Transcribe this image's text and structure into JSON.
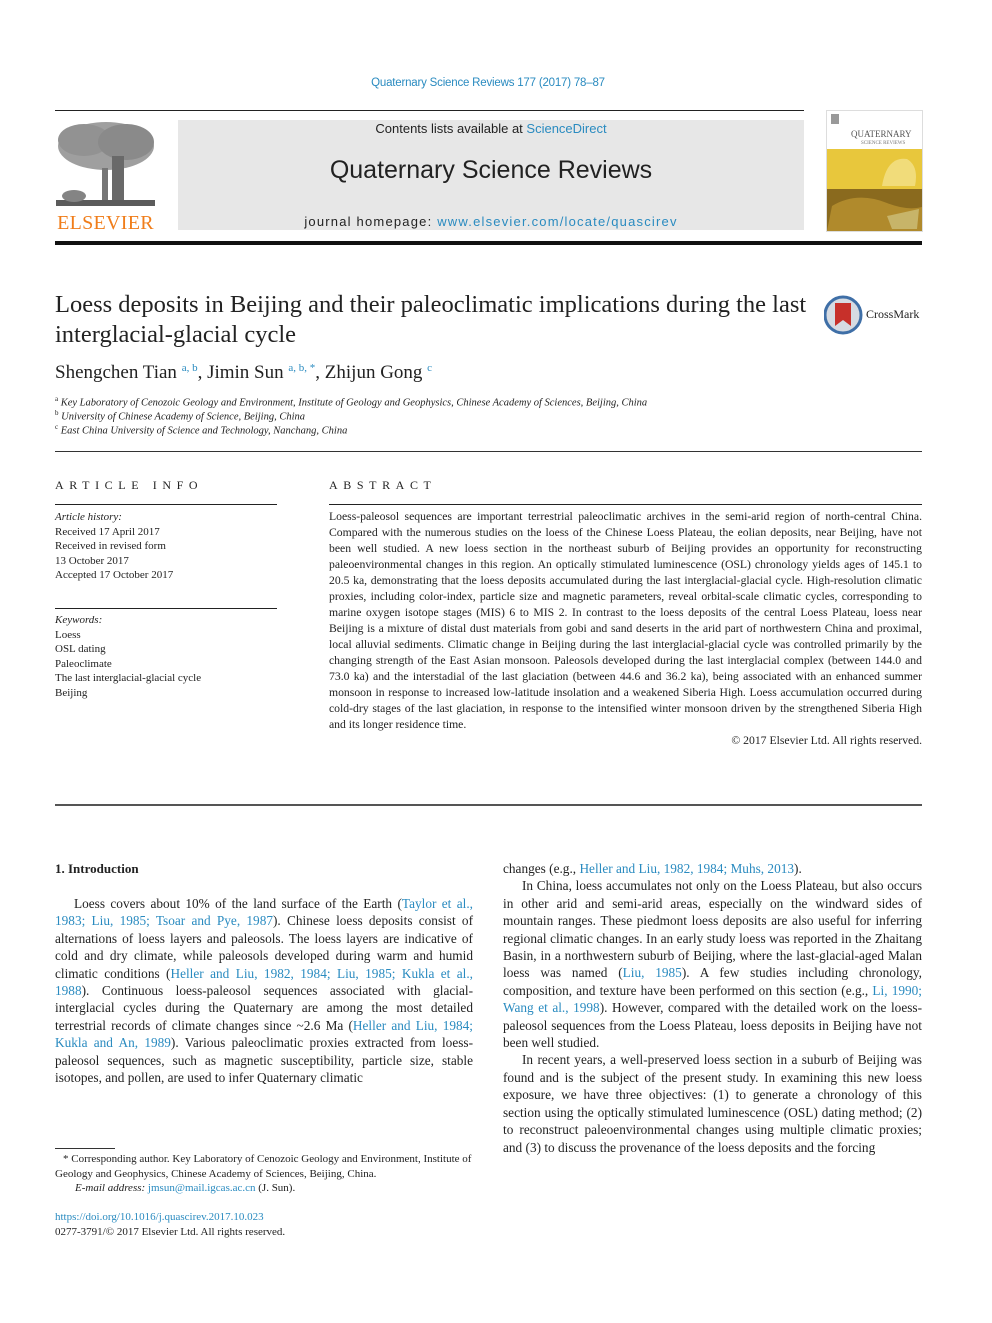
{
  "header": {
    "journal_reference": "Quaternary Science Reviews 177 (2017) 78–87",
    "contents_prefix": "Contents lists available at ",
    "contents_link": "ScienceDirect",
    "journal_title": "Quaternary Science Reviews",
    "homepage_prefix": "journal homepage: ",
    "homepage_link": "www.elsevier.com/locate/quascirev",
    "publisher_logo_text": "ELSEVIER",
    "cover_title": "QUATERNARY",
    "cover_subtitle": "SCIENCE REVIEWS",
    "brand_color": "#f07d1a",
    "link_color": "#2a8bc0"
  },
  "article": {
    "title": "Loess deposits in Beijing and their paleoclimatic implications during the last interglacial-glacial cycle",
    "crossmark_label": "CrossMark",
    "authors": [
      {
        "name": "Shengchen Tian",
        "affil": "a, b"
      },
      {
        "name": "Jimin Sun",
        "affil": "a, b, *"
      },
      {
        "name": "Zhijun Gong",
        "affil": "c"
      }
    ],
    "affiliations": [
      {
        "mark": "a",
        "text": "Key Laboratory of Cenozoic Geology and Environment, Institute of Geology and Geophysics, Chinese Academy of Sciences, Beijing, China"
      },
      {
        "mark": "b",
        "text": "University of Chinese Academy of Science, Beijing, China"
      },
      {
        "mark": "c",
        "text": "East China University of Science and Technology, Nanchang, China"
      }
    ]
  },
  "article_info": {
    "heading": "ARTICLE INFO",
    "history_label": "Article history:",
    "history": [
      "Received 17 April 2017",
      "Received in revised form",
      "13 October 2017",
      "Accepted 17 October 2017"
    ],
    "keywords_label": "Keywords:",
    "keywords": [
      "Loess",
      "OSL dating",
      "Paleoclimate",
      "The last interglacial-glacial cycle",
      "Beijing"
    ]
  },
  "abstract": {
    "heading": "ABSTRACT",
    "text": "Loess-paleosol sequences are important terrestrial paleoclimatic archives in the semi-arid region of north-central China. Compared with the numerous studies on the loess of the Chinese Loess Plateau, the eolian deposits, near Beijing, have not been well studied. A new loess section in the northeast suburb of Beijing provides an opportunity for reconstructing paleoenvironmental changes in this region. An optically stimulated luminescence (OSL) chronology yields ages of 145.1 to 20.5 ka, demonstrating that the loess deposits accumulated during the last interglacial-glacial cycle. High-resolution climatic proxies, including color-index, particle size and magnetic parameters, reveal orbital-scale climatic cycles, corresponding to marine oxygen isotope stages (MIS) 6 to MIS 2. In contrast to the loess deposits of the central Loess Plateau, loess near Beijing is a mixture of distal dust materials from gobi and sand deserts in the arid part of northwestern China and proximal, local alluvial sediments. Climatic change in Beijing during the last interglacial-glacial cycle was controlled primarily by the changing strength of the East Asian monsoon. Paleosols developed during the last interglacial complex (between 144.0 and 73.0 ka) and the interstadial of the last glaciation (between 44.6 and 36.2 ka), being associated with an enhanced summer monsoon in response to increased low-latitude insolation and a weakened Siberia High. Loess accumulation occurred during cold-dry stages of the last glaciation, in response to the intensified winter monsoon driven by the strengthened Siberia High and its longer residence time.",
    "copyright": "© 2017 Elsevier Ltd. All rights reserved."
  },
  "body": {
    "section_heading": "1.  Introduction",
    "left_paragraph": [
      {
        "t": "Loess covers about 10% of the land surface of the Earth ("
      },
      {
        "l": "Taylor et al., 1983; Liu, 1985; Tsoar and Pye, 1987"
      },
      {
        "t": "). Chinese loess deposits consist of alternations of loess layers and paleosols. The loess layers are indicative of cold and dry climate, while paleosols developed during warm and humid climatic conditions ("
      },
      {
        "l": "Heller and Liu, 1982, 1984; Liu, 1985; Kukla et al., 1988"
      },
      {
        "t": "). Continuous loess-paleosol sequences associated with glacial-interglacial cycles during the Quaternary are among the most detailed terrestrial records of climate changes since ~2.6 Ma ("
      },
      {
        "l": "Heller and Liu, 1984; Kukla and An, 1989"
      },
      {
        "t": "). Various paleoclimatic proxies extracted from loess-paleosol sequences, such as magnetic susceptibility, particle size, stable isotopes, and pollen, are used to infer Quaternary climatic"
      }
    ],
    "right_continuation": [
      {
        "t": "changes (e.g., "
      },
      {
        "l": "Heller and Liu, 1982, 1984; Muhs, 2013"
      },
      {
        "t": ")."
      }
    ],
    "right_paragraph_2": [
      {
        "t": "In China, loess accumulates not only on the Loess Plateau, but also occurs in other arid and semi-arid areas, especially on the windward sides of mountain ranges. These piedmont loess deposits are also useful for inferring regional climatic changes. In an early study loess was reported in the Zhaitang Basin, in a northwestern suburb of Beijing, where the last-glacial-aged Malan loess was named ("
      },
      {
        "l": "Liu, 1985"
      },
      {
        "t": "). A few studies including chronology, composition, and texture have been performed on this section (e.g., "
      },
      {
        "l": "Li, 1990; Wang et al., 1998"
      },
      {
        "t": "). However, compared with the detailed work on the loess-paleosol sequences from the Loess Plateau, loess deposits in Beijing have not been well studied."
      }
    ],
    "right_paragraph_3": [
      {
        "t": "In recent years, a well-preserved loess section in a suburb of Beijing was found and is the subject of the present study. In examining this new loess exposure, we have three objectives: (1) to generate a chronology of this section using the optically stimulated luminescence (OSL) dating method; (2) to reconstruct paleoenvironmental changes using multiple climatic proxies; and (3) to discuss the provenance of the loess deposits and the forcing"
      }
    ]
  },
  "footnote": {
    "corresponding": "* Corresponding author. Key Laboratory of Cenozoic Geology and Environment, Institute of Geology and Geophysics, Chinese Academy of Sciences, Beijing, China.",
    "email_label": "E-mail address: ",
    "email": "jmsun@mail.igcas.ac.cn",
    "email_suffix": " (J. Sun).",
    "doi": "https://doi.org/10.1016/j.quascirev.2017.10.023",
    "issn": "0277-3791/© 2017 Elsevier Ltd. All rights reserved."
  }
}
